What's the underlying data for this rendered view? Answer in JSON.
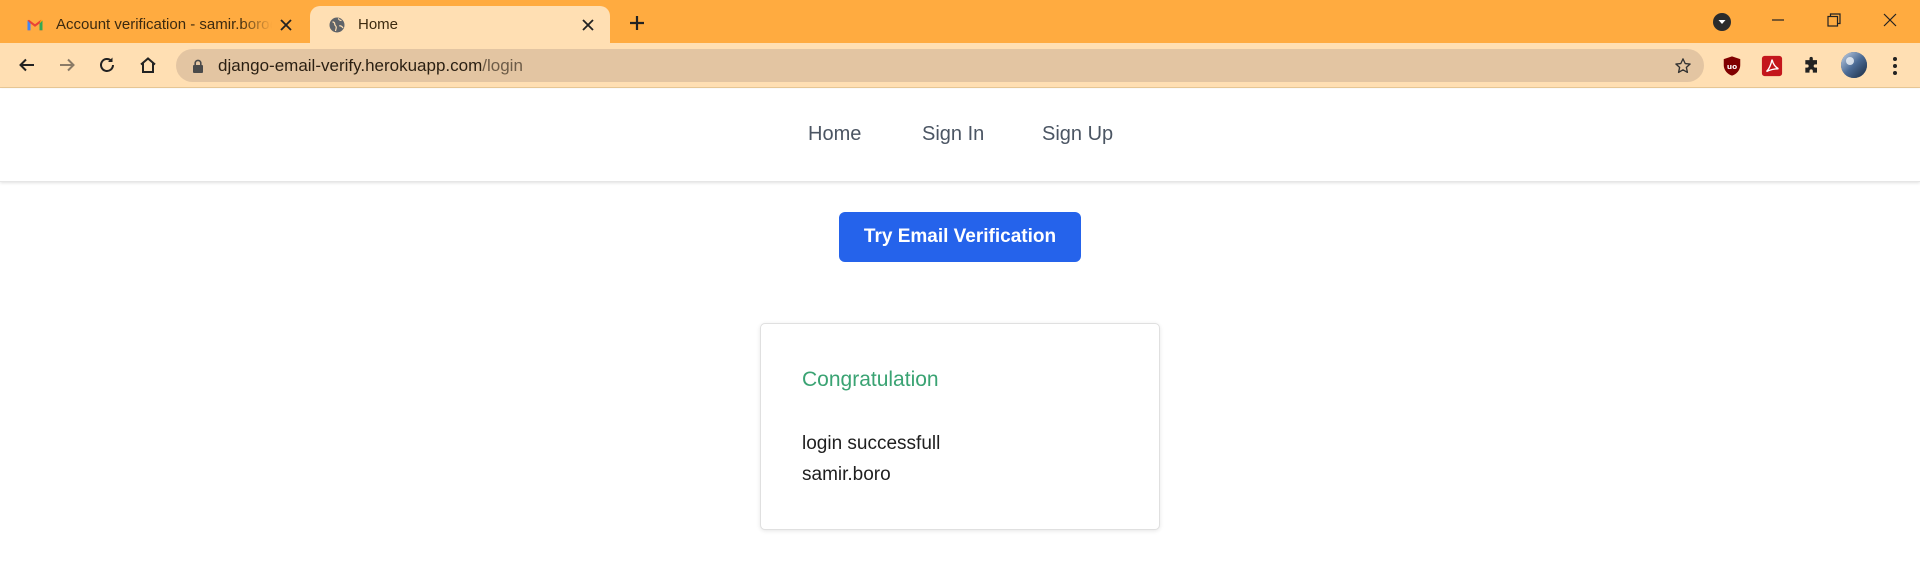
{
  "browser": {
    "tabs": [
      {
        "title": "Account verification - samir.boro@gmail.com - Gmail",
        "favicon": "gmail-icon",
        "active": false
      },
      {
        "title": "Home",
        "favicon": "globe-icon",
        "active": true
      }
    ],
    "url": {
      "domain": "django-email-verify.herokuapp.com",
      "path": "/login"
    },
    "toolbar_icons": [
      "back-icon",
      "forward-icon",
      "reload-icon",
      "home-icon",
      "lock-icon",
      "star-icon",
      "ublock-icon",
      "pdf-icon",
      "extensions-icon",
      "profile-avatar",
      "menu-icon"
    ],
    "colors": {
      "tabstrip": "#ffab40",
      "active_tab": "#ffdfb3",
      "omnibox": "#e3c5a2"
    }
  },
  "nav": {
    "items": [
      {
        "label": "Home"
      },
      {
        "label": "Sign In"
      },
      {
        "label": "Sign Up"
      }
    ]
  },
  "cta": {
    "label": "Try Email Verification",
    "color": "#2563eb"
  },
  "card": {
    "title": "Congratulation",
    "title_color": "#3aa373",
    "lines": [
      "login successfull",
      "samir.boro"
    ]
  }
}
